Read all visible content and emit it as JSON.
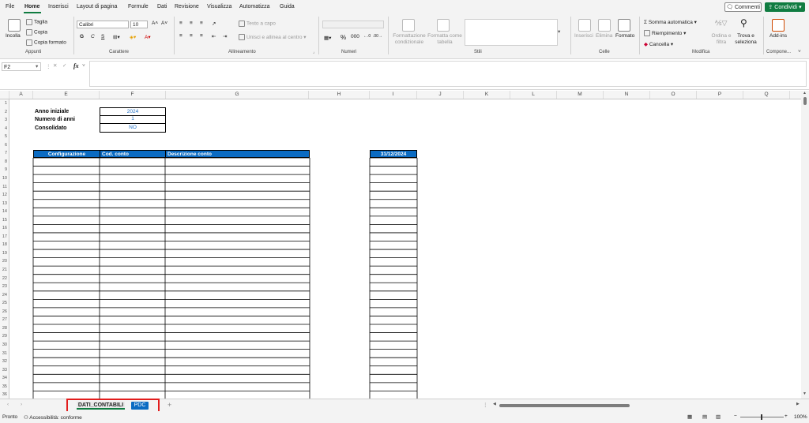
{
  "menu": {
    "tabs": [
      "File",
      "Home",
      "Inserisci",
      "Layout di pagina",
      "Formule",
      "Dati",
      "Revisione",
      "Visualizza",
      "Automatizza",
      "Guida"
    ],
    "comments_label": "Commenti",
    "share_label": "Condividi"
  },
  "ribbon": {
    "clipboard": {
      "paste": "Incolla",
      "cut": "Taglia",
      "copy": "Copia",
      "format_painter": "Copia formato",
      "label": "Appunti"
    },
    "font": {
      "name": "Calibri",
      "size": "10",
      "label": "Carattere"
    },
    "alignment": {
      "wrap": "Testo a capo",
      "merge": "Unisci e allinea al centro",
      "label": "Allineamento"
    },
    "number": {
      "format": "",
      "label": "Numeri"
    },
    "styles": {
      "conditional": "Formattazione condizionale",
      "as_table": "Formatta come tabella",
      "label": "Stili"
    },
    "cells": {
      "insert": "Inserisci",
      "delete": "Elimina",
      "format": "Formato",
      "label": "Celle"
    },
    "editing": {
      "autosum": "Somma automatica",
      "fill": "Riempimento",
      "clear": "Cancella",
      "sort": "Ordina e filtra",
      "find": "Trova e seleziona",
      "label": "Modifica"
    },
    "addins": {
      "addins": "Add-ins",
      "label": "Compone..."
    }
  },
  "formula_bar": {
    "name_box": "F2",
    "fx": "fx",
    "content": ""
  },
  "columns": [
    "A",
    "E",
    "F",
    "G",
    "H",
    "I",
    "J",
    "K",
    "L",
    "M",
    "N",
    "O",
    "P",
    "Q"
  ],
  "rows": [
    "1",
    "2",
    "3",
    "4",
    "5",
    "6",
    "7",
    "8",
    "9",
    "10",
    "11",
    "12",
    "13",
    "14",
    "15",
    "16",
    "17",
    "18",
    "19",
    "20",
    "21",
    "22",
    "23",
    "24",
    "25",
    "26",
    "27",
    "28",
    "29",
    "30",
    "31",
    "32",
    "33",
    "34",
    "35",
    "36"
  ],
  "sheet": {
    "anno_label": "Anno iniziale",
    "anno_value": "2024",
    "numero_label": "Numero di anni",
    "numero_value": "1",
    "consolidato_label": "Consolidato",
    "consolidato_value": "NO",
    "table_headers": [
      "Configurazione",
      "Cod. conto",
      "Descrizione conto"
    ],
    "date_header": "31/12/2024"
  },
  "tabs": {
    "active": "DATI_CONTABILI",
    "other": "PDC"
  },
  "status": {
    "ready": "Pronto",
    "accessibility": "Accessibilità: conforme",
    "zoom": "100%"
  }
}
